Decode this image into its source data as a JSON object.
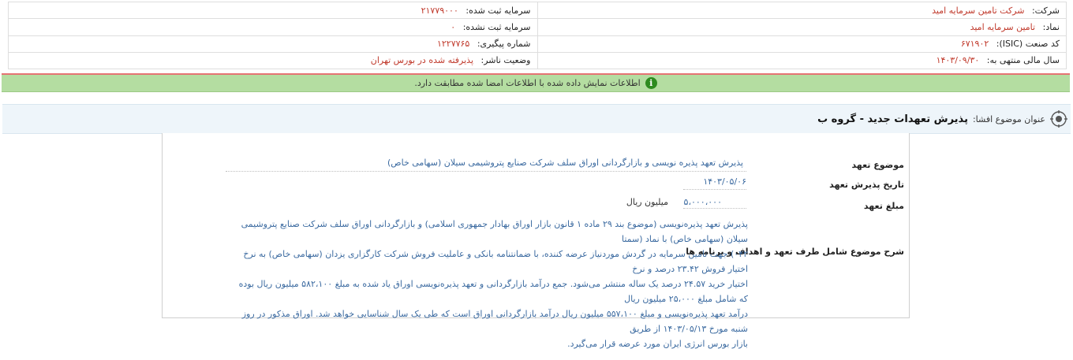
{
  "company": {
    "company_label": "شرکت:",
    "company_value": "شرکت تامین سرمایه امید",
    "symbol_label": "نماد:",
    "symbol_value": "تامین سرمایه امید",
    "isic_label": "کد صنعت (ISIC):",
    "isic_value": "۶۷۱۹۰۲",
    "fiscal_label": "سال مالی منتهی به:",
    "fiscal_value": "۱۴۰۳/۰۹/۳۰",
    "registered_capital_label": "سرمایه ثبت شده:",
    "registered_capital_value": "۲۱۷۷۹۰۰۰",
    "unregistered_capital_label": "سرمایه ثبت نشده:",
    "unregistered_capital_value": "۰",
    "tracking_label": "شماره پیگیری:",
    "tracking_value": "۱۲۲۷۷۶۵",
    "status_label": "وضعیت ناشر:",
    "status_value": "پذیرفته شده در بورس تهران"
  },
  "notice": {
    "icon": "info-icon",
    "text": "اطلاعات نمایش داده شده با اطلاعات امضا شده مطابقت دارد."
  },
  "subject": {
    "icon": "target-icon",
    "label": "عنوان موضوع افشا:",
    "title": "پذیرش تعهدات جدید - گروه ب"
  },
  "details": {
    "topic_label": "موضوع تعهد",
    "topic_value": "پذیرش تعهد پذیره نویسی و بازارگردانی اوراق سلف شرکت صنایع پتروشیمی سیلان (سهامی خاص)",
    "date_label": "تاریخ پذیرش تعهد",
    "date_value": "۱۴۰۳/۰۵/۰۶",
    "amount_label": "مبلغ تعهد",
    "amount_value": "۵،۰۰۰،۰۰۰",
    "amount_unit": "میلیون ریال",
    "description_label": "شرح موضوع شامل طرف تعهد و اهداف و برنامه ها",
    "description_lines": [
      "پذیرش تعهد پذیره‌نویسی (موضوع بند ۲۹ ماده ۱ قانون بازار اوراق بهادار جمهوری اسلامی) و بازارگردانی اوراق سلف شرکت صنایع پتروشیمی سیلان (سهامی خاص) با نماد (سمتا",
      "۰۴۲) جهت تامین سرمایه در گردش موردنیاز عرضه کننده، با ضمانتنامه بانکی و عاملیت فروش شرکت کارگزاری یزدان (سهامی خاص) به نرخ اختیار فروش ۲۳.۴۲ درصد و نرخ",
      "اختیار خرید ۲۴.۵۷ درصد یک ساله منتشر می‌شود. جمع درآمد بازارگردانی و تعهد پذیره‌نویسی اوراق یاد شده به مبلغ ۵۸۲،۱۰۰ میلیون ریال بوده که شامل مبلغ ۲۵،۰۰۰ میلیون ریال",
      "درآمد تعهد پذیره‌نویسی و مبلغ ۵۵۷،۱۰۰ میلیون ریال درآمد بازارگردانی اوراق است که طی یک سال شناسایی خواهد شد. اوراق مذکور در روز شنبه مورخ ۱۴۰۳/۰۵/۱۳ از طریق",
      "بازار بورس انرژی ایران مورد عرضه قرار می‌گیرد."
    ]
  }
}
